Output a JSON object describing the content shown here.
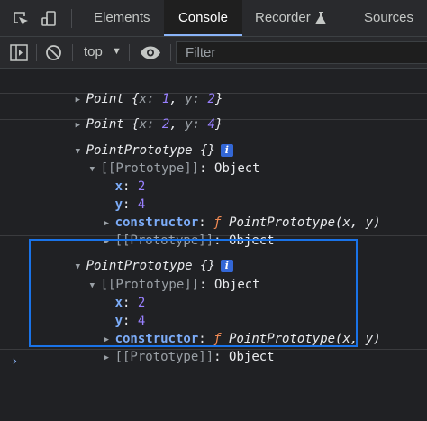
{
  "tabs": [
    {
      "label": "Elements",
      "active": false
    },
    {
      "label": "Console",
      "active": true
    },
    {
      "label": "Recorder",
      "active": false
    },
    {
      "label": "Sources",
      "active": false
    }
  ],
  "toolbar": {
    "context": "top",
    "filter_placeholder": "Filter"
  },
  "console": {
    "point1": {
      "name": "Point",
      "open": "{",
      "x_key": "x",
      "colon": ":",
      "x": "1",
      "comma": ",",
      "y_key": "y",
      "y": "2",
      "close": "}"
    },
    "point2": {
      "name": "Point",
      "open": "{",
      "x_key": "x",
      "colon": ":",
      "x": "2",
      "comma": ",",
      "y_key": "y",
      "y": "4",
      "close": "}"
    },
    "proto_obj": {
      "header": "PointPrototype {}",
      "info": "i",
      "proto_label": "[[Prototype]]",
      "proto_colon": ":",
      "proto_value": "Object",
      "x_key": "x",
      "x_val": "2",
      "y_key": "y",
      "y_val": "4",
      "ctor_key": "constructor",
      "ctor_f": "ƒ",
      "ctor_sig": "PointPrototype(x, y)",
      "colon": ":"
    }
  },
  "colors": {
    "accent": "#8ab4f8",
    "number": "#9980ff",
    "property": "#7cacf8",
    "function_keyword": "#f28b54",
    "highlight_border": "#1a73e8"
  },
  "icons": [
    "inspect-element-icon",
    "device-toolbar-icon",
    "flask-icon",
    "sidebar-toggle-icon",
    "clear-console-icon",
    "dropdown-arrow-icon",
    "eye-icon",
    "disclosure-triangle-icon",
    "info-icon",
    "prompt-chevron-icon"
  ]
}
